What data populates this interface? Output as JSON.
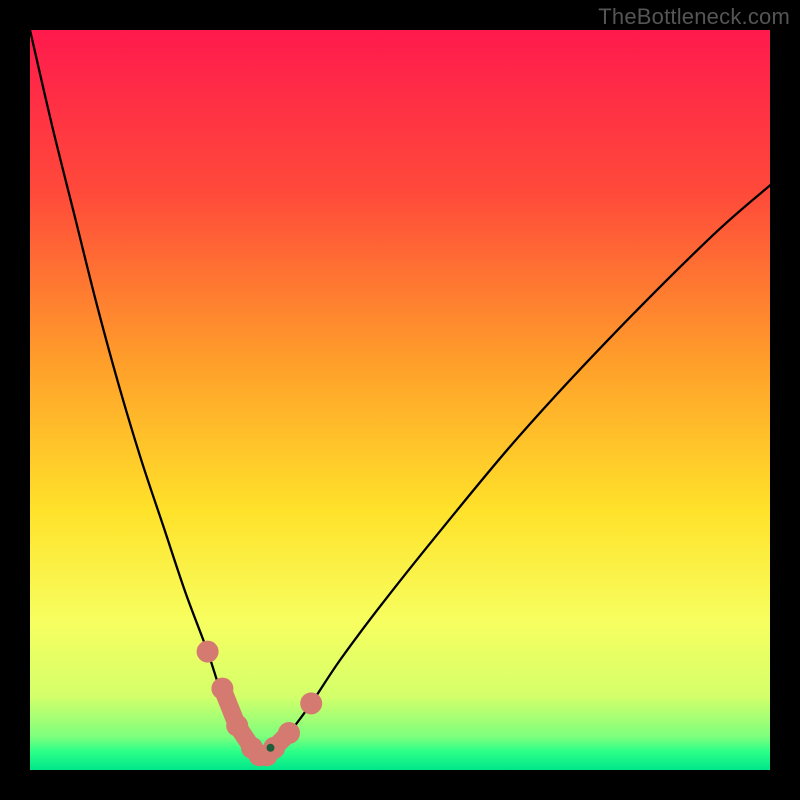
{
  "watermark": "TheBottleneck.com",
  "chart_data": {
    "type": "line",
    "title": "",
    "xlabel": "",
    "ylabel": "",
    "xlim": [
      0,
      100
    ],
    "ylim": [
      0,
      100
    ],
    "grid": false,
    "legend": false,
    "series": [
      {
        "name": "bottleneck-curve",
        "x": [
          0,
          3,
          6,
          9,
          12,
          15,
          18,
          21,
          24,
          26,
          28,
          30,
          31,
          32,
          33,
          35,
          38,
          42,
          48,
          56,
          66,
          78,
          92,
          100
        ],
        "y": [
          100,
          87,
          75,
          63,
          52,
          42,
          33,
          24,
          16,
          10,
          6,
          3,
          2,
          2,
          3,
          5,
          9,
          15,
          23,
          33,
          45,
          58,
          72,
          79
        ]
      }
    ],
    "annotations": {
      "gradient_stops": [
        {
          "pos": 0.0,
          "color": "#ff1a4d"
        },
        {
          "pos": 0.22,
          "color": "#ff4a3a"
        },
        {
          "pos": 0.45,
          "color": "#ff9f2a"
        },
        {
          "pos": 0.65,
          "color": "#ffe22a"
        },
        {
          "pos": 0.8,
          "color": "#f7ff60"
        },
        {
          "pos": 0.9,
          "color": "#d4ff6a"
        },
        {
          "pos": 0.955,
          "color": "#7dff7d"
        },
        {
          "pos": 0.975,
          "color": "#2cff88"
        },
        {
          "pos": 1.0,
          "color": "#00e68a"
        }
      ],
      "marker_segments": [
        {
          "x": [
            26,
            28,
            30,
            31,
            32,
            33,
            35
          ],
          "y": [
            11,
            6,
            3,
            2,
            2,
            3,
            5
          ]
        }
      ],
      "marker_single": [
        {
          "x": 24,
          "y": 16
        },
        {
          "x": 38,
          "y": 9
        }
      ],
      "marker_color": "#d47a70",
      "minimum_dot": {
        "x": 32.5,
        "y": 3,
        "color": "#1a5f3a"
      }
    }
  }
}
